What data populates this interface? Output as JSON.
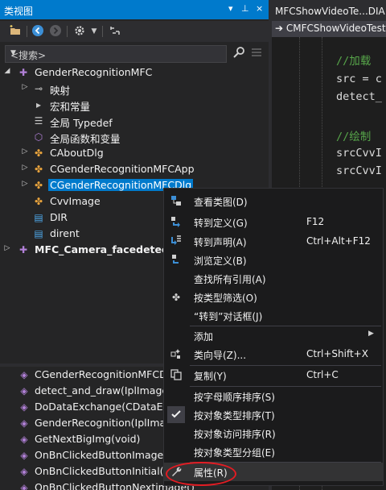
{
  "panel": {
    "title": "类视图",
    "title_controls": [
      "▾",
      "⊥",
      "×"
    ],
    "search_placeholder": "<搜索>"
  },
  "tree": [
    {
      "label": "GenderRecognitionMFC",
      "icon": "project-icon",
      "expander": "expanded"
    },
    {
      "label": "映射",
      "icon": "map-icon",
      "expander": "collapsed"
    },
    {
      "label": "宏和常量",
      "icon": "macro-icon",
      "expander": "none"
    },
    {
      "label": "全局 Typedef",
      "icon": "typedef-icon",
      "expander": "none"
    },
    {
      "label": "全局函数和变量",
      "icon": "global-function-icon",
      "expander": "none"
    },
    {
      "label": "CAboutDlg",
      "icon": "class-icon",
      "expander": "collapsed"
    },
    {
      "label": "CGenderRecognitionMFCApp",
      "icon": "class-icon",
      "expander": "collapsed"
    },
    {
      "label": "CGenderRecognitionMFCDlg",
      "icon": "class-icon",
      "expander": "collapsed",
      "selected": true
    },
    {
      "label": "CvvImage",
      "icon": "class-icon",
      "expander": "none"
    },
    {
      "label": "DIR",
      "icon": "struct-icon",
      "expander": "none"
    },
    {
      "label": "dirent",
      "icon": "struct-icon",
      "expander": "none"
    },
    {
      "label": "MFC_Camera_facedetection",
      "icon": "project-icon",
      "expander": "collapsed",
      "bold": true
    }
  ],
  "members": [
    "CGenderRecognitionMFCDlg",
    "detect_and_draw(IplImage *",
    "DoDataExchange(CDataExch",
    "GenderRecognition(IplImag",
    "GetNextBigImg(void)",
    "OnBnClickedButtonImagefile",
    "OnBnClickedButtonInitial()",
    "OnBnClickedButtonNextimage()"
  ],
  "editor": {
    "tab_title": "MFCShowVideoTe...DIA",
    "nav_label": "CMFCShowVideoTest",
    "lines": [
      {
        "text": "//加载",
        "kind": "comment"
      },
      {
        "text": "src = c",
        "kind": "plain"
      },
      {
        "text": "detect_",
        "kind": "plain"
      },
      {
        "text": "",
        "kind": "plain"
      },
      {
        "text": "//绘制",
        "kind": "comment"
      },
      {
        "text": "srcCvvI",
        "kind": "plain"
      },
      {
        "text": "srcCvvI",
        "kind": "plain"
      }
    ]
  },
  "context_menu": {
    "items": [
      {
        "label": "查看类图(D)",
        "shortcut": "",
        "icon": "class-diagram-icon"
      },
      {
        "label": "转到定义(G)",
        "shortcut": "F12",
        "icon": "go-to-definition-icon"
      },
      {
        "label": "转到声明(A)",
        "shortcut": "Ctrl+Alt+F12",
        "icon": "go-to-declaration-icon"
      },
      {
        "label": "浏览定义(B)",
        "shortcut": "",
        "icon": "browse-definition-icon"
      },
      {
        "label": "查找所有引用(A)",
        "shortcut": "",
        "icon": ""
      },
      {
        "label": "按类型筛选(O)",
        "shortcut": "",
        "icon": "filter-by-type-icon"
      },
      {
        "label": "“转到”对话框(J)",
        "shortcut": "",
        "icon": ""
      },
      {
        "label": "添加",
        "shortcut": "",
        "icon": "",
        "submenu": true
      },
      {
        "label": "类向导(Z)...",
        "shortcut": "Ctrl+Shift+X",
        "icon": "class-wizard-icon"
      },
      {
        "label": "复制(Y)",
        "shortcut": "Ctrl+C",
        "icon": "copy-icon"
      },
      {
        "label": "按字母顺序排序(S)",
        "shortcut": "",
        "icon": ""
      },
      {
        "label": "按对象类型排序(T)",
        "shortcut": "",
        "icon": "check-icon",
        "checked": true
      },
      {
        "label": "按对象访问排序(R)",
        "shortcut": "",
        "icon": ""
      },
      {
        "label": "按对象类型分组(E)",
        "shortcut": "",
        "icon": ""
      },
      {
        "label": "属性(R)",
        "shortcut": "",
        "icon": "wrench-icon",
        "highlighted": true
      }
    ]
  }
}
